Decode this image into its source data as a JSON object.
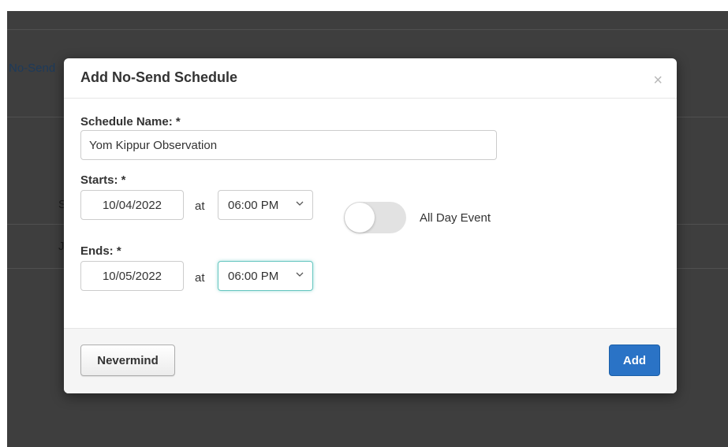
{
  "background": {
    "link_fragment": "No-Send",
    "fragment_s": "S",
    "fragment_j": "J"
  },
  "modal": {
    "title": "Add No-Send Schedule",
    "close_glyph": "×",
    "schedule_name_label": "Schedule Name: *",
    "schedule_name_value": "Yom Kippur Observation",
    "starts_label": "Starts: *",
    "start_date": "10/04/2022",
    "start_at": "at",
    "start_time": "06:00 PM",
    "all_day_label": "All Day Event",
    "all_day_enabled": false,
    "ends_label": "Ends: *",
    "end_date": "10/05/2022",
    "end_at": "at",
    "end_time": "06:00 PM",
    "cancel_label": "Nevermind",
    "submit_label": "Add"
  },
  "colors": {
    "overlay": "#3b3b3b",
    "primary": "#2a73c6",
    "focus": "#66c6c0"
  }
}
